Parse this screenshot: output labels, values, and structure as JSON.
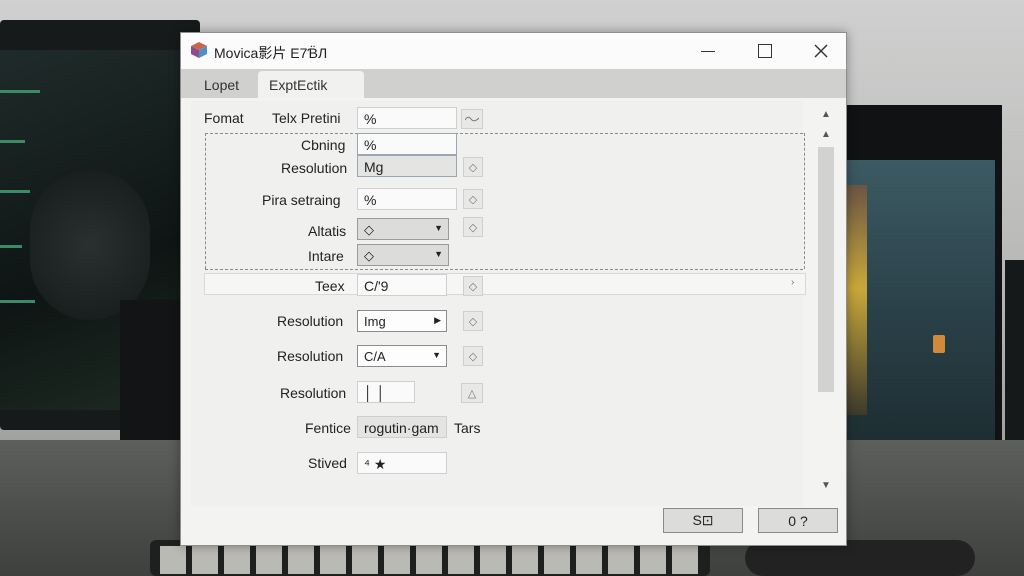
{
  "window": {
    "title": "Movica影片 E7Ɓ̈Л",
    "app_icon": "cube-app-icon"
  },
  "tabs": [
    {
      "label": "Lopet",
      "active": false
    },
    {
      "label": "ExptEctik",
      "active": true
    }
  ],
  "header": {
    "format_label": "Fomat",
    "telx_label": "Telx Pretini",
    "telx_value": "%"
  },
  "group": {
    "cbning_label": "Cbning",
    "cbning_value": "%",
    "resolution_label": "Resolution",
    "resolution_value": "Mg",
    "pira_label": "Pira setraing",
    "pira_value": "%",
    "altatis_label": "Altatis",
    "altatis_value": "◇",
    "intare_label": "Intare",
    "intare_value": "◇"
  },
  "rows": {
    "teex_label": "Teex",
    "teex_value": "C/ʹ9",
    "res1_label": "Resolution",
    "res1_value": "Img",
    "res2_label": "Resolution",
    "res2_value": "C/A",
    "res3_label": "Resolution",
    "res3_value": "│ │",
    "fentice_label": "Fentice",
    "fentice_value": "rogutin·gam",
    "fentice_suffix": "Tars",
    "stived_label": "Stived",
    "stived_value": "⁴ ★"
  },
  "buttons": {
    "primary_label": "S⊡",
    "secondary_label": "0 ?"
  },
  "colors": {
    "dialog_bg": "#f3f3f2",
    "tab_strip": "#d0d0cf",
    "button_bg": "#dcdcdb"
  }
}
